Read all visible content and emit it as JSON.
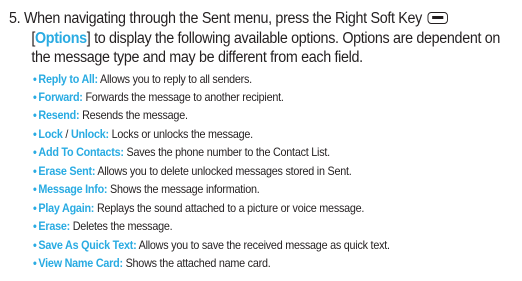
{
  "step": {
    "number": "5.",
    "line1": "When navigating through the Sent menu, press the Right Soft Key",
    "bracket_open": "[",
    "options_keyword": "Options",
    "line2_rest": "] to display the following available options. Options are dependent on",
    "line3": "the message type and may be different from each field."
  },
  "options": [
    {
      "bullet": "•",
      "label": "Reply to All:",
      "desc": " Allows you to reply to all senders."
    },
    {
      "bullet": "•",
      "label": "Forward:",
      "desc": " Forwards the message to another recipient."
    },
    {
      "bullet": "•",
      "label": "Resend:",
      "desc": " Resends the message."
    },
    {
      "bullet": "•",
      "label": "Lock",
      "sep": " / ",
      "label2": "Unlock:",
      "desc": " Locks or unlocks the message."
    },
    {
      "bullet": "•",
      "label": "Add To Contacts:",
      "desc": " Saves the phone number to the Contact List."
    },
    {
      "bullet": "•",
      "label": "Erase Sent:",
      "desc": " Allows you to delete unlocked messages stored in Sent."
    },
    {
      "bullet": "•",
      "label": "Message Info:",
      "desc": " Shows the message information."
    },
    {
      "bullet": "•",
      "label": "Play Again:",
      "desc": " Replays the sound attached to a picture or voice message."
    },
    {
      "bullet": "•",
      "label": "Erase:",
      "desc": " Deletes the message."
    },
    {
      "bullet": "•",
      "label": "Save As Quick Text:",
      "desc": " Allows you to save the received message as quick text."
    },
    {
      "bullet": "•",
      "label": "View Name Card:",
      "desc": " Shows the attached name card."
    }
  ],
  "colors": {
    "accent": "#29abe2",
    "text": "#231f20"
  },
  "icons": {
    "right_soft_key": "right-soft-key-icon"
  }
}
